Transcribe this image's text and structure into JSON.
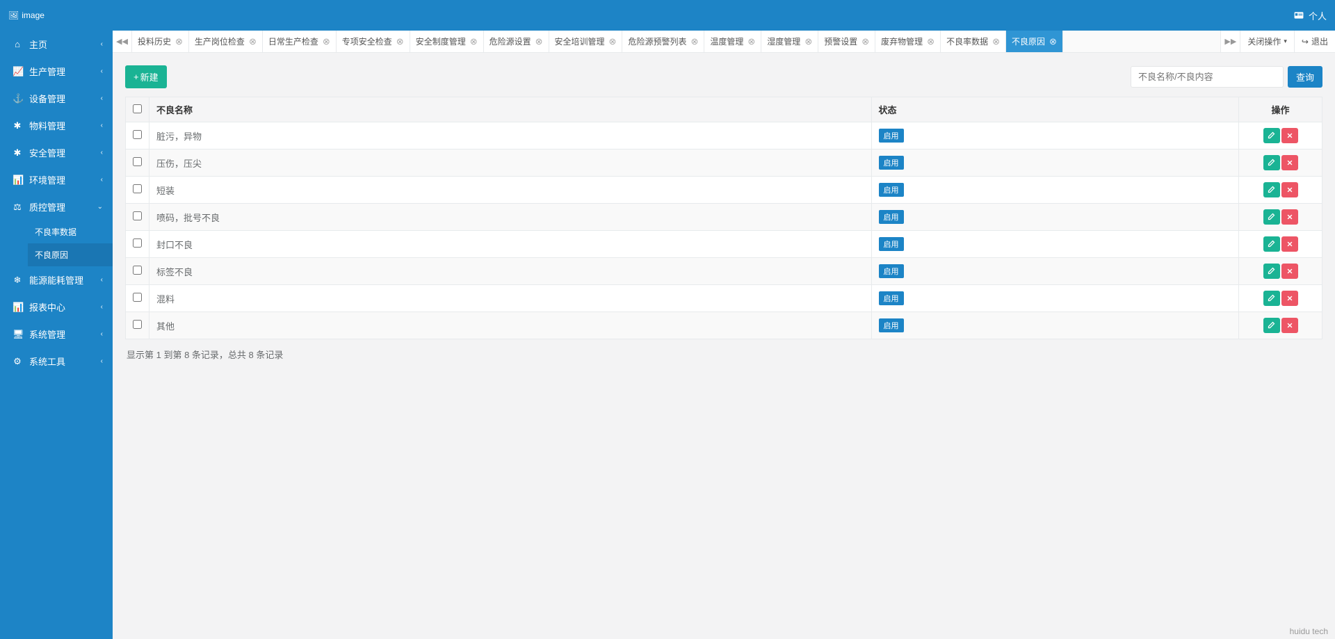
{
  "app": {
    "logo_text": "image",
    "user_label": "个人"
  },
  "sidebar": [
    {
      "icon": "⌂",
      "label": "主页"
    },
    {
      "icon": "📈",
      "label": "生产管理"
    },
    {
      "icon": "⚓",
      "label": "设备管理"
    },
    {
      "icon": "✱",
      "label": "物料管理"
    },
    {
      "icon": "✱",
      "label": "安全管理"
    },
    {
      "icon": "📊",
      "label": "环境管理"
    },
    {
      "icon": "⚖",
      "label": "质控管理",
      "open": true,
      "children": [
        "不良率数据",
        "不良原因"
      ],
      "active_child": 1
    },
    {
      "icon": "❄",
      "label": "能源能耗管理"
    },
    {
      "icon": "📊",
      "label": "报表中心"
    },
    {
      "icon": "🖥",
      "label": "系统管理"
    },
    {
      "icon": "⚙",
      "label": "系统工具"
    }
  ],
  "tabs": {
    "items": [
      {
        "label": "投料历史"
      },
      {
        "label": "生产岗位检查"
      },
      {
        "label": "日常生产检查"
      },
      {
        "label": "专项安全检查"
      },
      {
        "label": "安全制度管理"
      },
      {
        "label": "危险源设置"
      },
      {
        "label": "安全培训管理"
      },
      {
        "label": "危险源预警列表"
      },
      {
        "label": "温度管理"
      },
      {
        "label": "湿度管理"
      },
      {
        "label": "预警设置"
      },
      {
        "label": "废弃物管理"
      },
      {
        "label": "不良率数据"
      },
      {
        "label": "不良原因",
        "active": true
      }
    ],
    "close_ops_label": "关闭操作",
    "exit_label": "退出"
  },
  "toolbar": {
    "new_label": "新建",
    "search_placeholder": "不良名称/不良内容",
    "search_btn": "查询"
  },
  "table": {
    "headers": {
      "name": "不良名称",
      "status": "状态",
      "ops": "操作"
    },
    "status_label": "启用",
    "rows": [
      {
        "name": "脏污，异物"
      },
      {
        "name": "压伤，压尖"
      },
      {
        "name": "短装"
      },
      {
        "name": "喷码，批号不良"
      },
      {
        "name": "封口不良"
      },
      {
        "name": "标签不良"
      },
      {
        "name": "混料"
      },
      {
        "name": "其他"
      }
    ]
  },
  "pagination": "显示第 1 到第 8 条记录，总共 8 条记录",
  "footer_brand": "huidu tech"
}
